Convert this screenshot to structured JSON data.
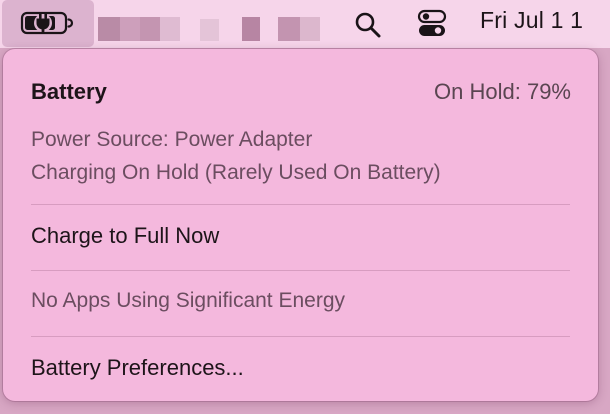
{
  "menubar": {
    "battery_icon": "battery-charging-plug-icon",
    "search_icon": "search-icon",
    "control_center_icon": "control-center-icon",
    "clock": "Fri Jul 1  1"
  },
  "battery_menu": {
    "title": "Battery",
    "status": "On Hold: 79%",
    "power_source": "Power Source: Power Adapter",
    "charging_state": "Charging On Hold (Rarely Used On Battery)",
    "charge_full_label": "Charge to Full Now",
    "energy_label": "No Apps Using Significant Energy",
    "preferences_label": "Battery Preferences..."
  },
  "colors": {
    "menu_background": "#f4b8dd",
    "menubar_background": "#f6d5ea",
    "highlighted_item": "#dcb3cf",
    "primary_text": "#1d1419",
    "secondary_text": "#6b4d60"
  }
}
